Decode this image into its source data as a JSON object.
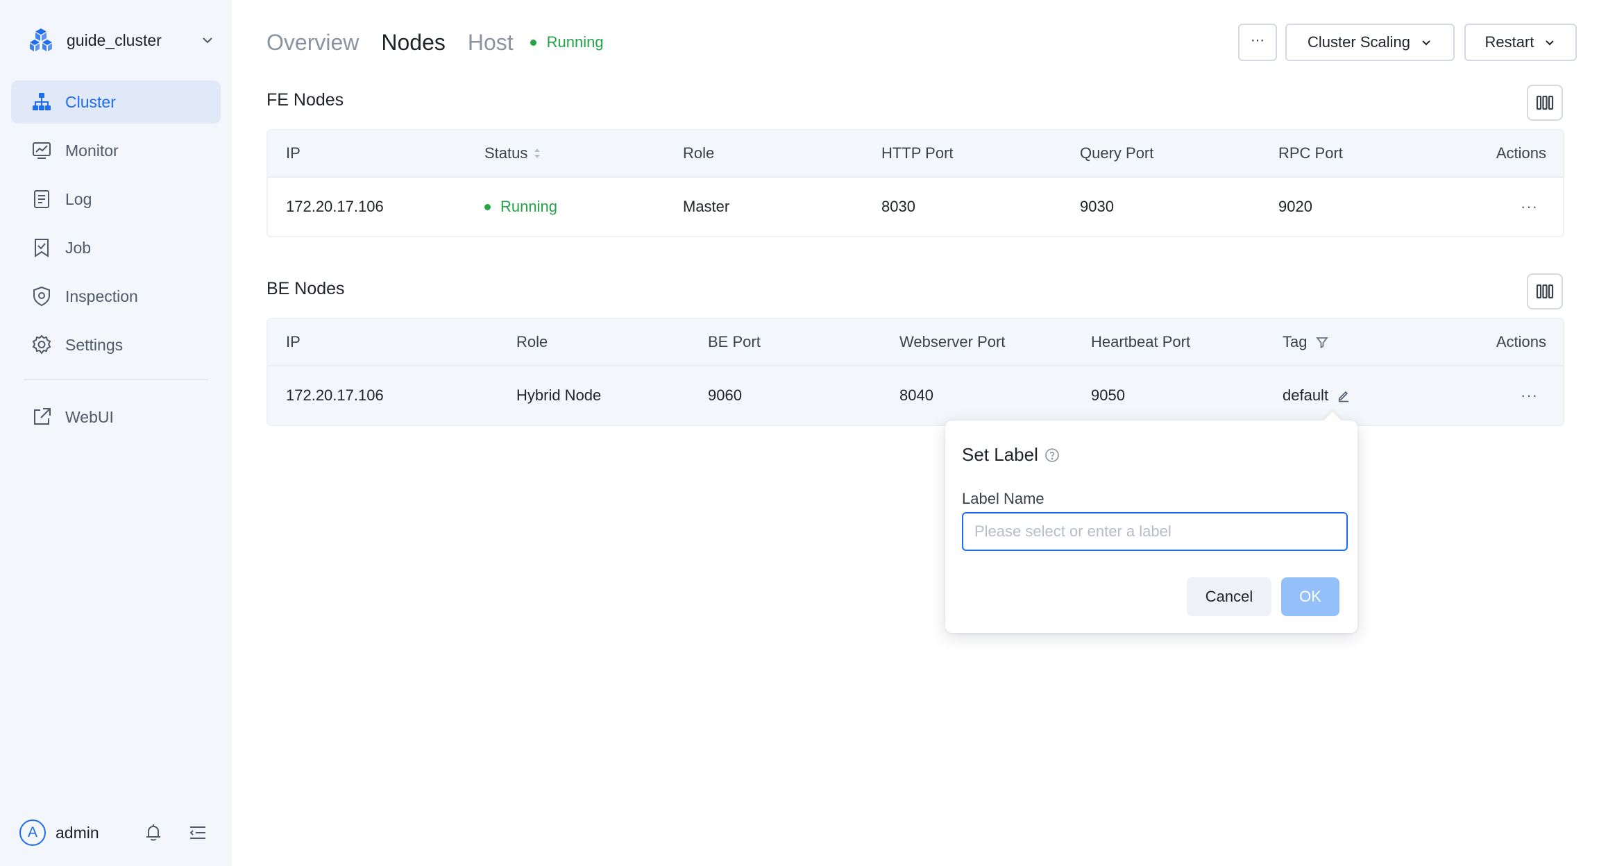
{
  "sidebar": {
    "cluster_name": "guide_cluster",
    "items": [
      {
        "label": "Cluster",
        "icon": "cluster-icon",
        "active": true
      },
      {
        "label": "Monitor",
        "icon": "monitor-icon"
      },
      {
        "label": "Log",
        "icon": "log-icon"
      },
      {
        "label": "Job",
        "icon": "job-icon"
      },
      {
        "label": "Inspection",
        "icon": "inspection-icon"
      },
      {
        "label": "Settings",
        "icon": "settings-icon"
      },
      {
        "label": "WebUI",
        "icon": "external-link-icon"
      }
    ],
    "user": {
      "avatar_letter": "A",
      "name": "admin"
    }
  },
  "header": {
    "tabs": [
      "Overview",
      "Nodes",
      "Host"
    ],
    "active_tab": "Nodes",
    "status": "Running",
    "more_label": "···",
    "scaling_label": "Cluster Scaling",
    "restart_label": "Restart"
  },
  "fe": {
    "title": "FE Nodes",
    "columns": [
      "IP",
      "Status",
      "Role",
      "HTTP Port",
      "Query Port",
      "RPC Port",
      "Actions"
    ],
    "rows": [
      {
        "ip": "172.20.17.106",
        "status": "Running",
        "role": "Master",
        "http_port": "8030",
        "query_port": "9030",
        "rpc_port": "9020",
        "actions": "···"
      }
    ]
  },
  "be": {
    "title": "BE Nodes",
    "columns": [
      "IP",
      "Role",
      "BE Port",
      "Webserver Port",
      "Heartbeat Port",
      "Tag",
      "Actions"
    ],
    "rows": [
      {
        "ip": "172.20.17.106",
        "role": "Hybrid Node",
        "be_port": "9060",
        "webserver_port": "8040",
        "heartbeat_port": "9050",
        "tag": "default",
        "actions": "···"
      }
    ]
  },
  "popover": {
    "title": "Set Label",
    "label": "Label Name",
    "placeholder": "Please select or enter a label",
    "cancel": "Cancel",
    "ok": "OK"
  },
  "colors": {
    "accent": "#1e6cf0",
    "running": "#22a447",
    "sidebar_bg": "#f3f6fb",
    "ok_disabled": "#94c0f9"
  }
}
